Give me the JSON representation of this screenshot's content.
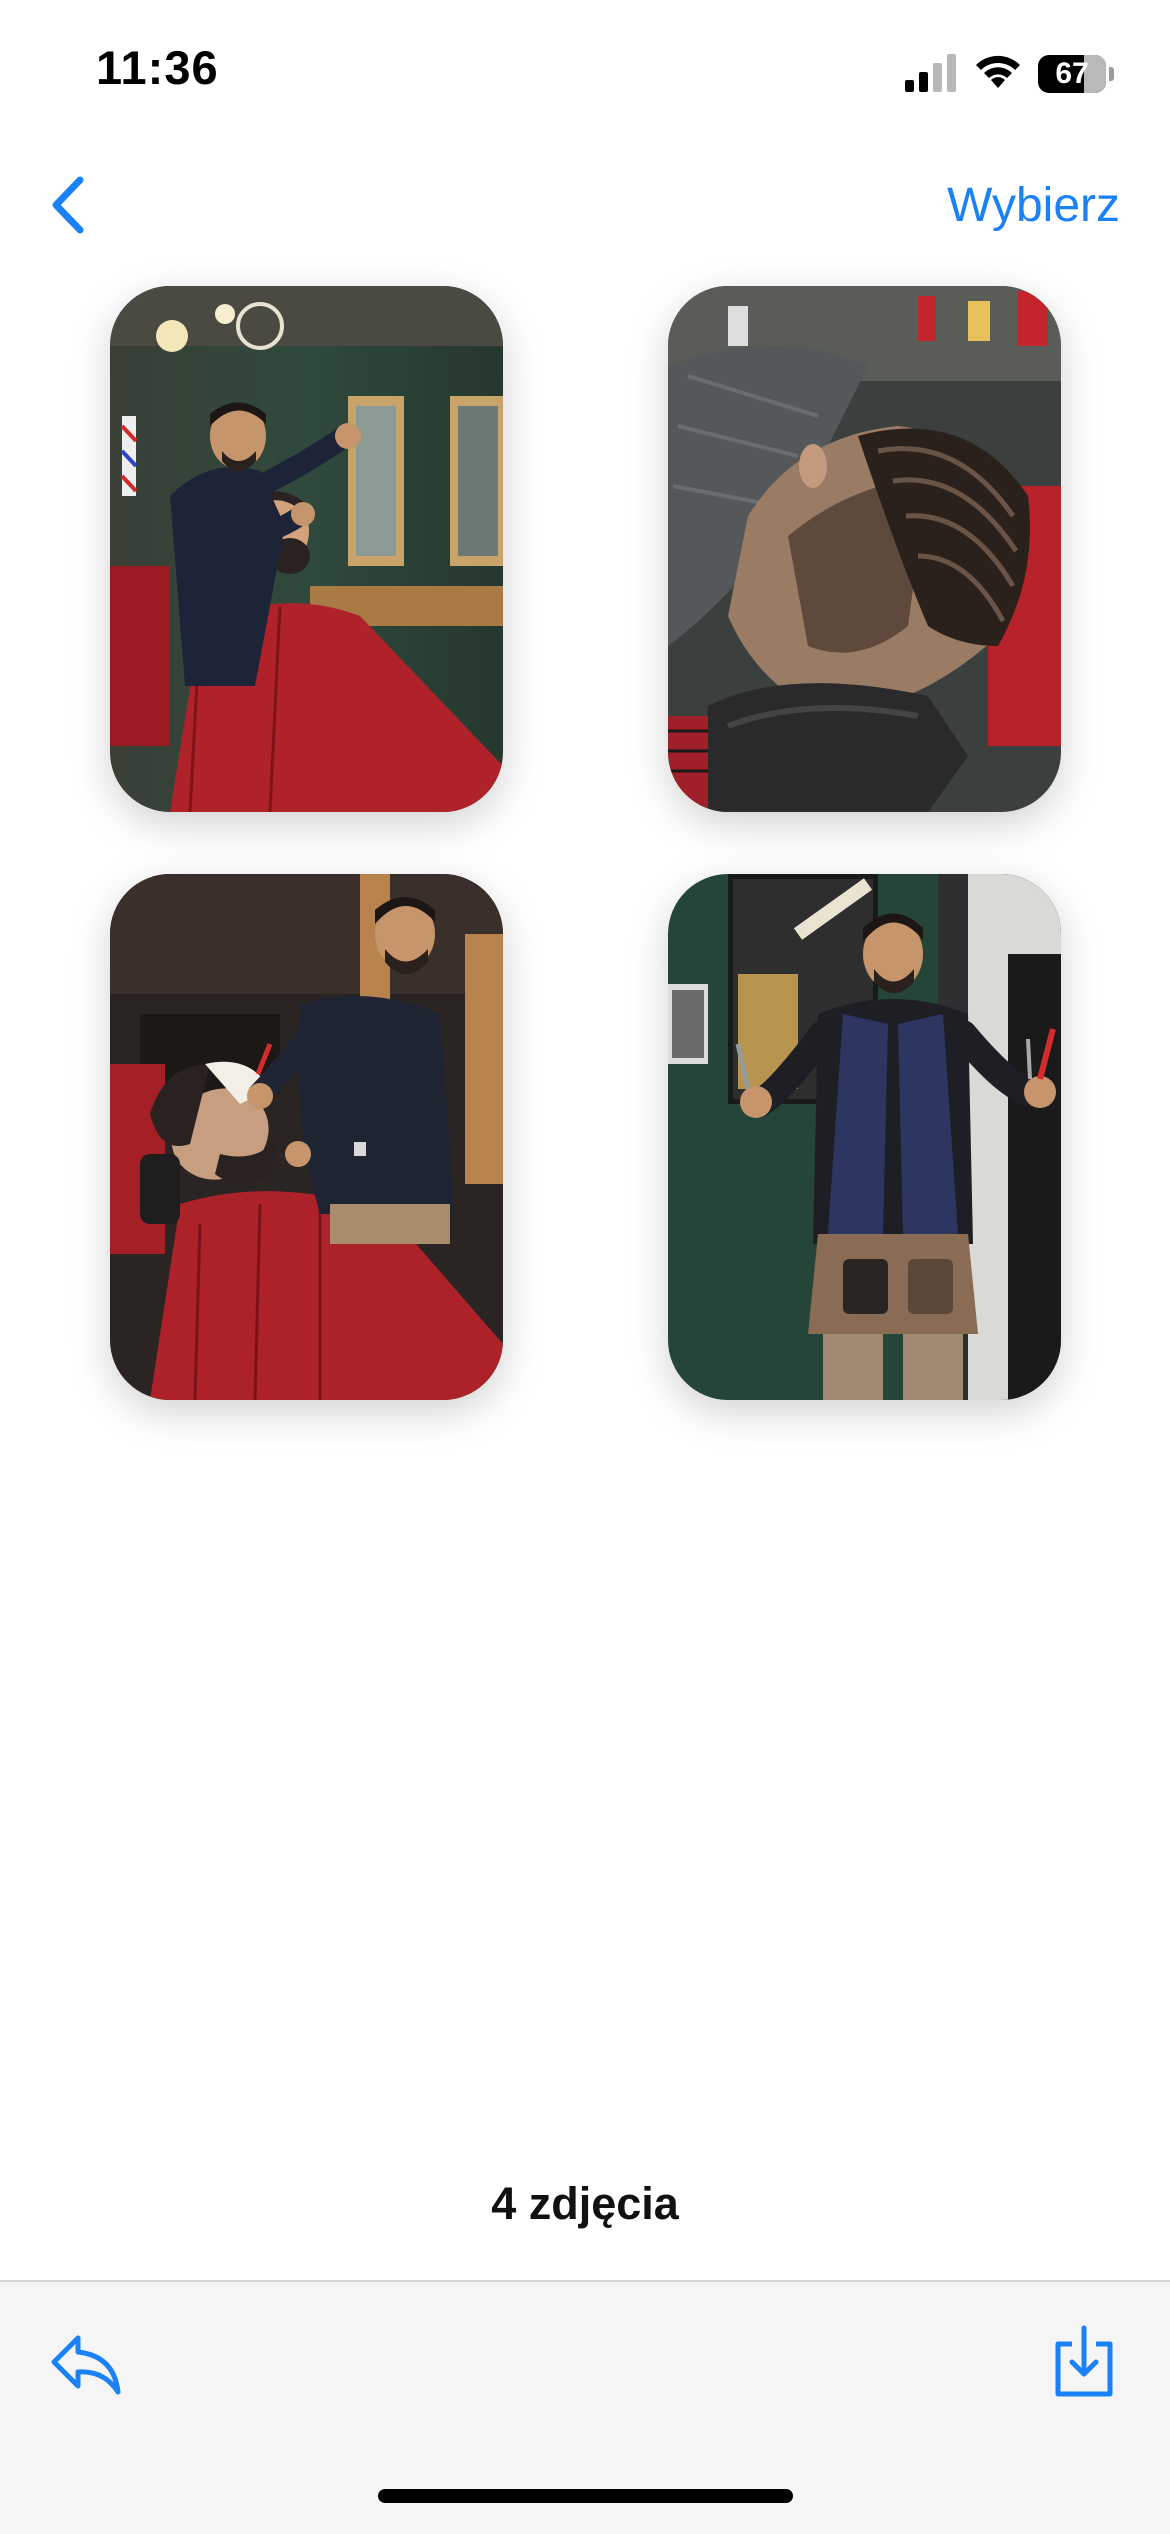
{
  "status_bar": {
    "time": "11:36",
    "battery_level": "67",
    "icons": [
      "signal-icon",
      "wifi-icon",
      "battery-icon"
    ]
  },
  "nav": {
    "back_icon": "chevron-left-icon",
    "select_label": "Wybierz"
  },
  "photos": [
    {
      "name": "photo-barber-styling-client"
    },
    {
      "name": "photo-slicked-hair-closeup"
    },
    {
      "name": "photo-barber-shaving-beard"
    },
    {
      "name": "photo-barber-posing-scissors"
    }
  ],
  "footer": {
    "count_label": "4 zdjęcia",
    "reply_icon": "reply-icon",
    "save_icon": "save-download-icon"
  },
  "colors": {
    "accent": "#1a82f6",
    "toolbar_bg": "#f5f5f5"
  }
}
